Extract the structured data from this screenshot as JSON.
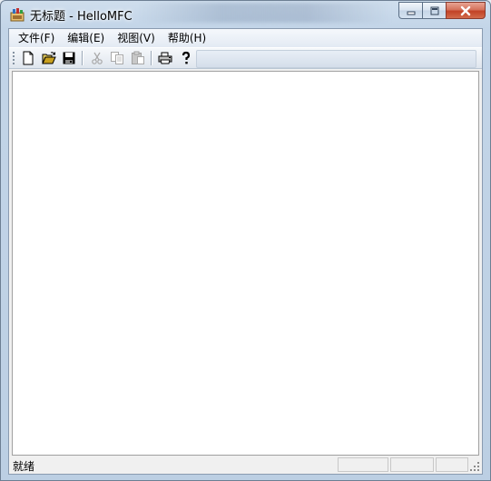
{
  "window": {
    "title": "无标题 - HelloMFC",
    "icon": "mfc-app-icon"
  },
  "caption_buttons": [
    "minimize",
    "maximize",
    "close"
  ],
  "menu": {
    "items": [
      {
        "label": "文件(F)"
      },
      {
        "label": "编辑(E)"
      },
      {
        "label": "视图(V)"
      },
      {
        "label": "帮助(H)"
      }
    ]
  },
  "toolbar": {
    "buttons": [
      {
        "icon": "new-file-icon",
        "enabled": true
      },
      {
        "icon": "open-folder-icon",
        "enabled": true
      },
      {
        "icon": "save-icon",
        "enabled": true
      },
      {
        "icon": "cut-icon",
        "enabled": false
      },
      {
        "icon": "copy-icon",
        "enabled": false
      },
      {
        "icon": "paste-icon",
        "enabled": false
      },
      {
        "icon": "print-icon",
        "enabled": true
      },
      {
        "icon": "help-icon",
        "enabled": true
      }
    ]
  },
  "status": {
    "text": "就绪"
  }
}
